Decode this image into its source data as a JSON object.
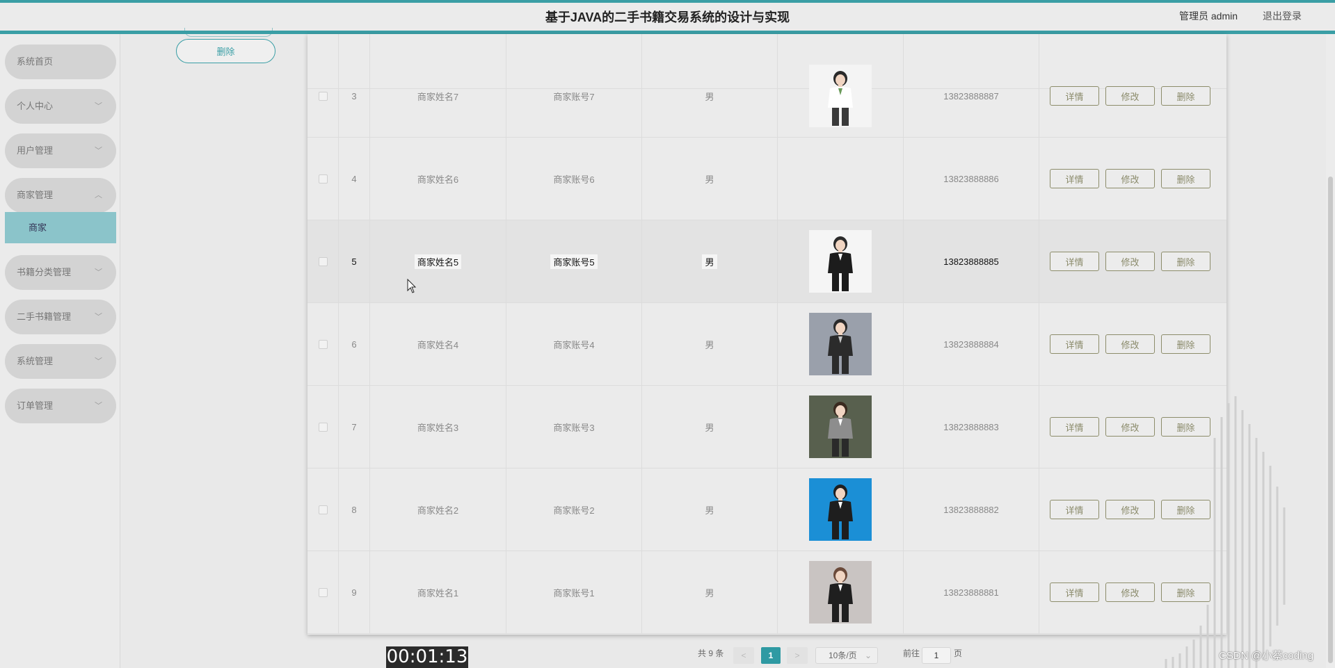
{
  "header": {
    "title": "基于JAVA的二手书籍交易系统的设计与实现",
    "user": "管理员 admin",
    "logout": "退出登录"
  },
  "sidebar": {
    "items": [
      {
        "label": "系统首页"
      },
      {
        "label": "个人中心"
      },
      {
        "label": "用户管理"
      },
      {
        "label": "商家管理"
      },
      {
        "label": "书籍分类管理"
      },
      {
        "label": "二手书籍管理"
      },
      {
        "label": "系统管理"
      },
      {
        "label": "订单管理"
      }
    ],
    "submenu_active": "商家"
  },
  "top_actions": {
    "delete_label": "删除"
  },
  "table": {
    "action_labels": {
      "detail": "详情",
      "edit": "修改",
      "delete": "删除"
    },
    "rows": [
      {
        "index": "3",
        "name": "商家姓名7",
        "account": "商家账号7",
        "gender": "男",
        "photo": "woman-white-blouse",
        "phone": "13823888887"
      },
      {
        "index": "4",
        "name": "商家姓名6",
        "account": "商家账号6",
        "gender": "男",
        "photo": "",
        "phone": "13823888886"
      },
      {
        "index": "5",
        "name": "商家姓名5",
        "account": "商家账号5",
        "gender": "男",
        "photo": "woman-black-suit",
        "phone": "13823888885"
      },
      {
        "index": "6",
        "name": "商家姓名4",
        "account": "商家账号4",
        "gender": "男",
        "photo": "woman-dark-suit-gray-bg",
        "phone": "13823888884"
      },
      {
        "index": "7",
        "name": "商家姓名3",
        "account": "商家账号3",
        "gender": "男",
        "photo": "woman-plaid-blazer",
        "phone": "13823888883"
      },
      {
        "index": "8",
        "name": "商家姓名2",
        "account": "商家账号2",
        "gender": "男",
        "photo": "woman-suit-blue-bg",
        "phone": "13823888882"
      },
      {
        "index": "9",
        "name": "商家姓名1",
        "account": "商家账号1",
        "gender": "男",
        "photo": "man-suit-bowtie",
        "phone": "13823888881"
      }
    ]
  },
  "pagination": {
    "total": "共 9 条",
    "prev": "<",
    "current": "1",
    "next": ">",
    "page_size": "10条/页",
    "goto_prefix": "前往",
    "goto_value": "1",
    "goto_suffix": "页"
  },
  "overlay": {
    "timer": "00:01:13",
    "watermark": "CSDN @小蔡coding"
  },
  "colors": {
    "accent": "#3a9ea5",
    "submenu_active": "#8bc4ca",
    "menu_pill": "#d3d3d3",
    "action_border": "#8c8c6a"
  }
}
